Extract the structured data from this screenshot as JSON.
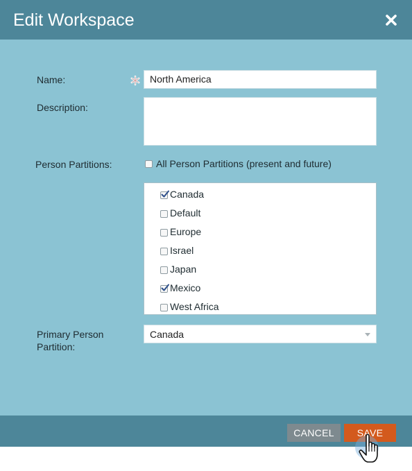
{
  "dialog": {
    "title": "Edit Workspace",
    "close_icon": "close-x-icon"
  },
  "form": {
    "name_label": "Name:",
    "name_value": "North America",
    "required_icon": "required-asterisk-icon",
    "description_label": "Description:",
    "description_value": "",
    "partitions_label": "Person Partitions:",
    "all_partitions_label": "All Person Partitions (present and future)",
    "all_partitions_checked": false,
    "partitions": [
      {
        "label": "Canada",
        "checked": true
      },
      {
        "label": "Default",
        "checked": false
      },
      {
        "label": "Europe",
        "checked": false
      },
      {
        "label": "Israel",
        "checked": false
      },
      {
        "label": "Japan",
        "checked": false
      },
      {
        "label": "Mexico",
        "checked": true
      },
      {
        "label": "West Africa",
        "checked": false
      }
    ],
    "primary_label_line1": "Primary Person",
    "primary_label_line2": "Partition:",
    "primary_value": "Canada"
  },
  "footer": {
    "cancel_label": "CANCEL",
    "save_label": "SAVE"
  },
  "colors": {
    "header": "#4d8699",
    "body": "#8bc3d3",
    "save": "#d35a1d",
    "cancel": "#7e8a8f"
  }
}
